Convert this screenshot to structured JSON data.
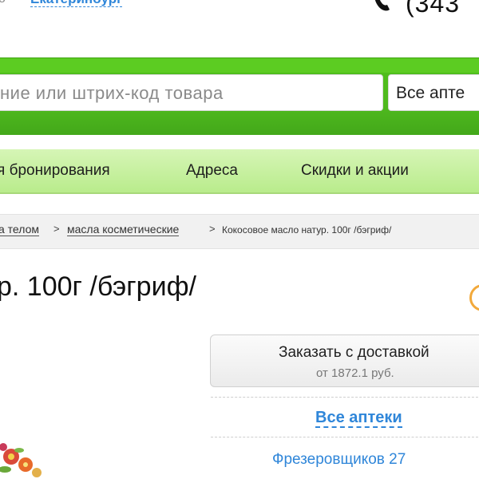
{
  "header": {
    "city_prefix": "о",
    "city": "Екатеринбург",
    "phone_icon": "phone-icon",
    "phone": "(343"
  },
  "search": {
    "placeholder": "ние или штрих-код товара",
    "pharmacy_select": "Все апте"
  },
  "nav": {
    "items": [
      {
        "label": "я бронирования"
      },
      {
        "label": "Адреса"
      },
      {
        "label": "Скидки и акции"
      }
    ]
  },
  "breadcrumbs": {
    "items": [
      {
        "label": "а телом"
      },
      {
        "label": "масла косметические"
      }
    ],
    "separator": ">",
    "current": "Кокосовое масло натур. 100г /бэгриф/"
  },
  "product": {
    "title": "р. 100г /бэгриф/",
    "order_button": "Заказать с доставкой",
    "price_from": "от 1872.1 руб.",
    "all_pharmacies": "Все аптеки",
    "address": "Фрезеровщиков 27"
  },
  "colors": {
    "brand_green": "#4fbe1c",
    "nav_green": "#c8f0a2",
    "link_blue": "#2f86d9",
    "info_orange": "#f2a93b"
  }
}
